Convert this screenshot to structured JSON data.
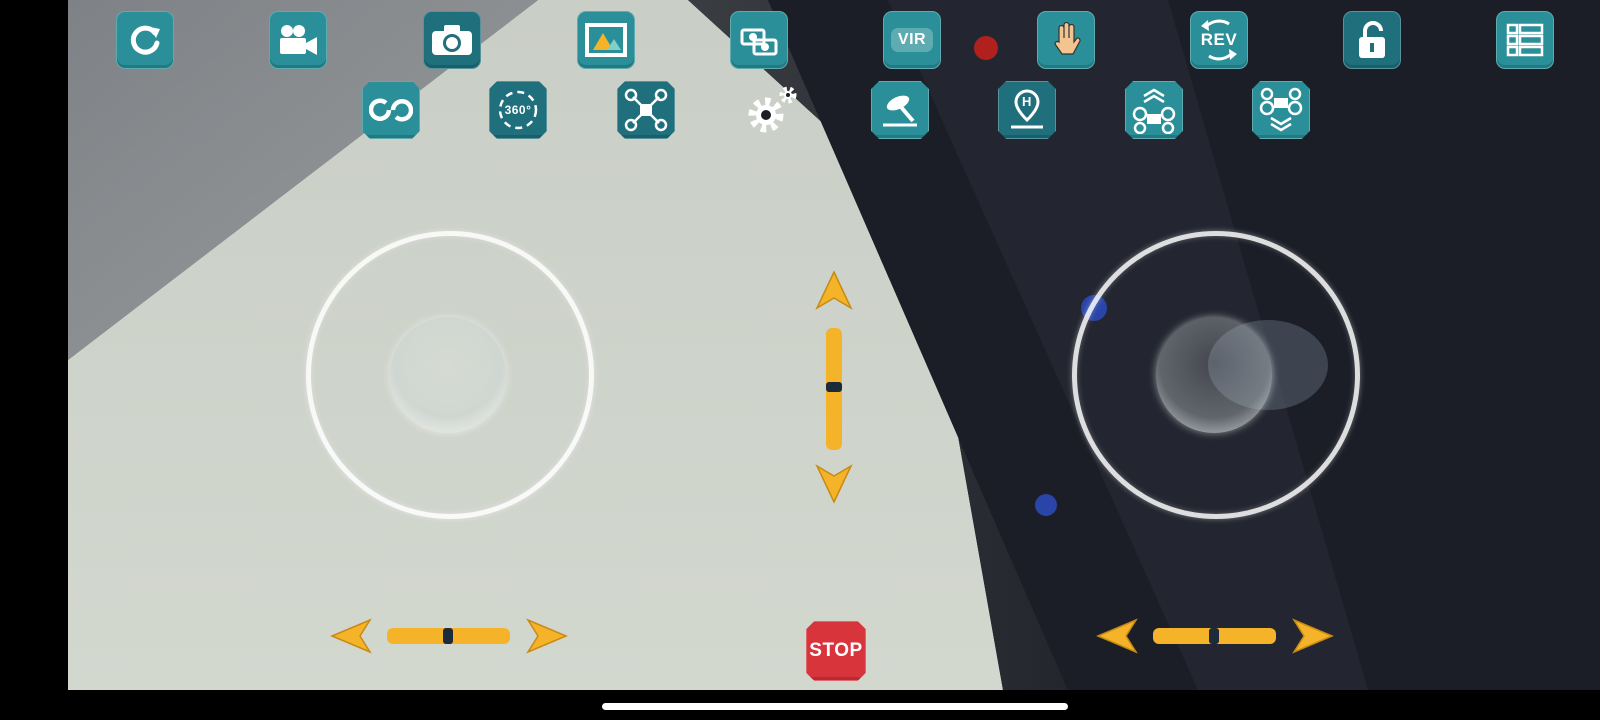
{
  "toolbar_top": [
    {
      "name": "rotate-icon",
      "label": ""
    },
    {
      "name": "video-camera-icon",
      "label": ""
    },
    {
      "name": "photo-camera-icon",
      "label": ""
    },
    {
      "name": "gallery-icon",
      "label": ""
    },
    {
      "name": "camera-switch-icon",
      "label": ""
    },
    {
      "name": "vr-button",
      "label": "VIR"
    },
    {
      "name": "gesture-hand-icon",
      "label": ""
    },
    {
      "name": "reverse-button",
      "label": "REV"
    },
    {
      "name": "lock-icon",
      "label": ""
    },
    {
      "name": "menu-list-icon",
      "label": ""
    }
  ],
  "toolbar_second": [
    {
      "name": "loop-icon",
      "label": ""
    },
    {
      "name": "rotate-360-icon",
      "label": "360°"
    },
    {
      "name": "headless-mode-icon",
      "label": ""
    },
    {
      "name": "settings-icon",
      "label": ""
    },
    {
      "name": "calibrate-gyro-icon",
      "label": ""
    },
    {
      "name": "return-home-icon",
      "label": "H"
    },
    {
      "name": "takeoff-icon",
      "label": ""
    },
    {
      "name": "land-icon",
      "label": ""
    }
  ],
  "stop_button": {
    "label": "STOP"
  },
  "colors": {
    "accent": "#2a8f98",
    "trim": "#f5b32a",
    "stop": "#d8343c"
  }
}
